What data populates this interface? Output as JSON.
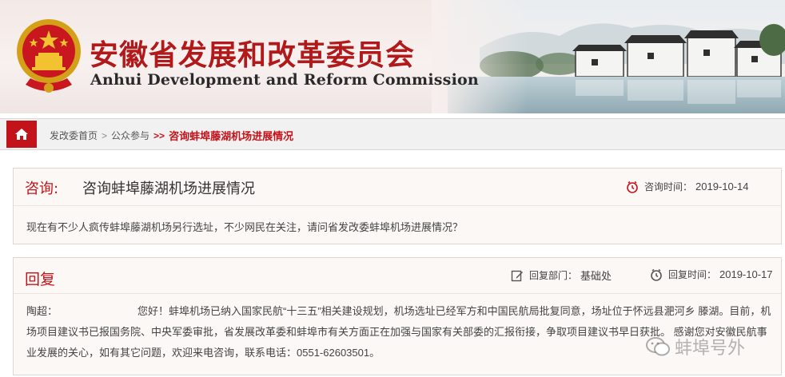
{
  "header": {
    "title_cn": "安徽省发展和改革委员会",
    "title_en": "Anhui Development and Reform Commission",
    "emblem_icon": "national-emblem",
    "brand_color": "#b2191b"
  },
  "breadcrumb": {
    "home_icon": "home-icon",
    "items": [
      "发改委首页",
      "公众参与"
    ],
    "separator": ">",
    "current_separator": ">>",
    "current": "咨询蚌埠藤湖机场进展情况"
  },
  "question": {
    "label": "咨询:",
    "title": "咨询蚌埠藤湖机场进展情况",
    "time_label": "咨询时间：",
    "time_value": "2019-10-14",
    "time_icon": "clock-icon",
    "body": "现在有不少人疯传蚌埠藤湖机场另行选址，不少网民在关注，请问省发改委蚌埠机场进展情况？"
  },
  "reply": {
    "label": "回复",
    "dept_label": "回复部门：",
    "dept_value": "基础处",
    "dept_icon": "edit-icon",
    "time_label": "回复时间：",
    "time_value": "2019-10-17",
    "time_icon": "clock-icon",
    "recipient": "陶超：",
    "body_line1": "您好！蚌埠机场已纳入国家民航“十三五”相关建设规划，机场选址已经军方和中国民航局批复同意，场址位于怀远县淝河乡",
    "body_rest": "滕湖。目前，机场项目建议书已报国务院、中央军委审批，省发展改革委和蚌埠市有关方面正在加强与国家有关部委的汇报衔接，争取项目建议书早日获批。  感谢您对安徽民航事业发展的关心，如有其它问题，欢迎来电咨询，联系电话：0551-62603501。"
  },
  "watermark": {
    "text": "蚌埠号外",
    "icon": "wechat-icon"
  },
  "colors": {
    "accent": "#c3131a",
    "panel_bg": "#fbf8f6",
    "panel_border": "#e2d6d3"
  }
}
